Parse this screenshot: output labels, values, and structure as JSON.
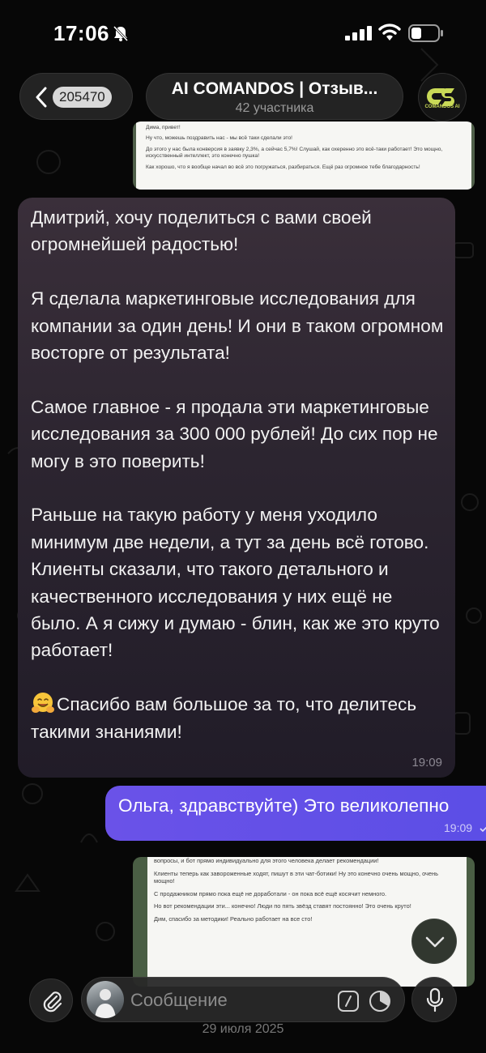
{
  "status_bar": {
    "time": "17:06"
  },
  "header": {
    "back_count": "205470",
    "title": "AI COMANDOS | Отзыв...",
    "subtitle": "42 участника",
    "logo_text": "COMANDOS AI"
  },
  "image_top": {
    "lines": [
      "Дима, привет!",
      "Ну что, можешь поздравить нас - мы всё таки сделали это!",
      "До этого у нас была конверсия в заявку 2,3%, а сейчас 5,7%! Слушай, как охеренно это всё-таки работает! Это мощно, искусственный интеллект, это конечно пушка!",
      "Как хорошо, что я вообще начал во всё это погружаться, разбираться. Ещё раз огромное тебе благодарность!"
    ]
  },
  "incoming_message": {
    "paragraphs": [
      "Дмитрий, хочу поделиться с вами своей огромнейшей радостью!",
      "Я сделала маркетинговые исследования для компании за один день! И они в таком огромном восторге от результата!",
      "Самое главное - я продала эти маркетинговые исследования за 300 000 рублей! До сих пор не могу в это поверить!",
      "Раньше на такую работу у меня уходило минимум две недели, а тут за день всё готово.",
      "Клиенты сказали, что такого детального и качественного исследования у них ещё не было. А я сижу и думаю - блин, как же это круто работает!",
      "Спасибо вам большое за то, что делитесь такими знаниями!"
    ],
    "time": "19:09"
  },
  "outgoing_message": {
    "text": "Ольга, здравствуйте) Это великолепно",
    "time": "19:09"
  },
  "image_bottom": {
    "lines": [
      "вопросы, и бот прямо индивидуально для этого человека делает рекомендации!",
      "Клиенты теперь как завороженные ходят, пишут в эти чат-ботики! Ну это конечно очень мощно, очень мощно!",
      "С продажником прямо пока ещё не доработали - он пока всё ещё косячит немного.",
      "Но вот рекомендации эти... конечно! Люди по пять звёзд ставят постоянно! Это очень круто!",
      "Дим, спасибо за методики! Реально работает на все сто!"
    ]
  },
  "input_bar": {
    "placeholder": "Сообщение"
  },
  "date_label": "29 июля 2025",
  "colors": {
    "outgoing_bubble": "#5b4ee6",
    "incoming_bubble": "#2c2530",
    "logo_accent": "#c9d957"
  },
  "icons": [
    "mute-icon",
    "signal-icon",
    "wifi-icon",
    "battery-icon",
    "chevron-left-icon",
    "paperclip-icon",
    "commands-icon",
    "schedule-icon",
    "microphone-icon",
    "chevron-down-icon",
    "double-check-icon",
    "hugging-face-emoji"
  ]
}
